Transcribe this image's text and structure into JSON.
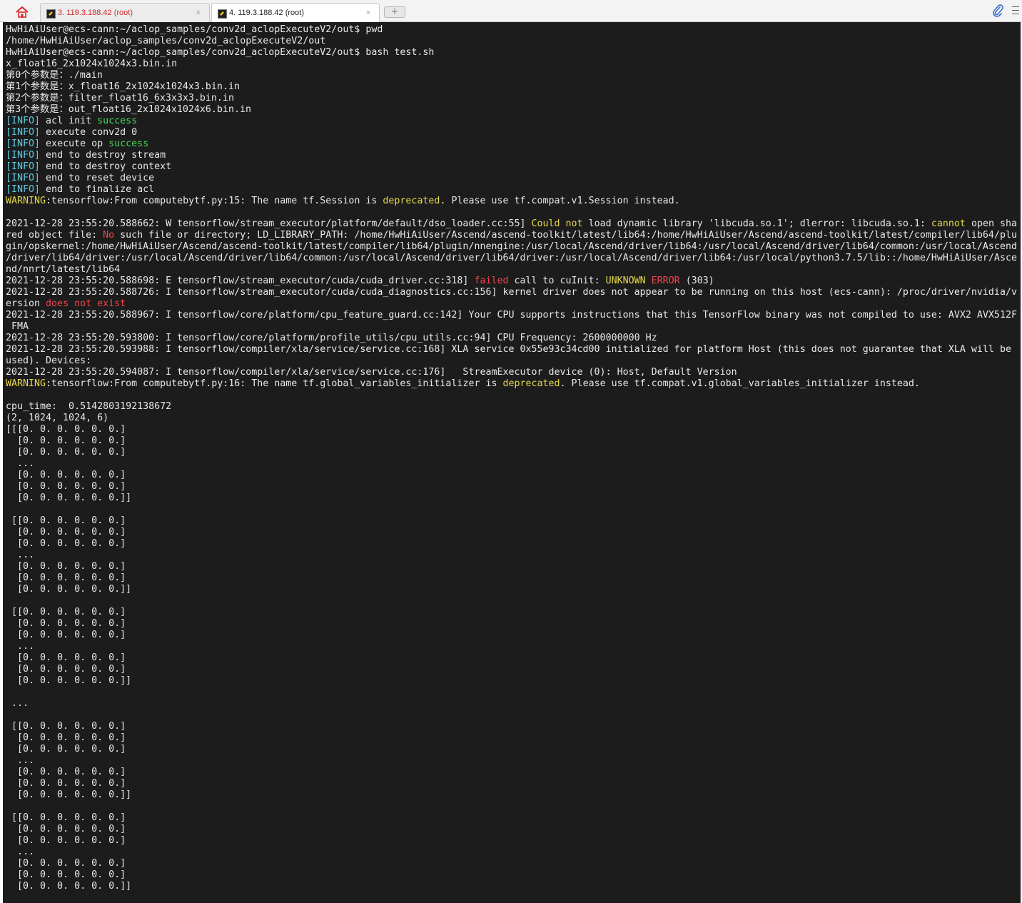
{
  "tabs": {
    "home_icon": "home-icon",
    "items": [
      {
        "label": "3. 119.3.188.42 (root)",
        "close": "×",
        "state": "inactive",
        "color": "#d9262b"
      },
      {
        "label": "4. 119.3.188.42 (root)",
        "close": "×",
        "state": "active",
        "color": "#222222"
      }
    ],
    "new_tab_label": "+"
  },
  "toolbar": {
    "attach_icon": "paperclip-icon",
    "menu_icon": "hamburger-menu-icon"
  },
  "colors": {
    "background": "#1c1c1c",
    "text": "#e8e8e8",
    "info": "#5fc8df",
    "success": "#45d85e",
    "warning": "#e6d94a",
    "error": "#f0464b"
  },
  "terminal": {
    "lines": [
      [
        {
          "t": "HwHiAiUser@ecs-cann:~/aclop_samples/conv2d_aclopExecuteV2/out$ pwd"
        }
      ],
      [
        {
          "t": "/home/HwHiAiUser/aclop_samples/conv2d_aclopExecuteV2/out"
        }
      ],
      [
        {
          "t": "HwHiAiUser@ecs-cann:~/aclop_samples/conv2d_aclopExecuteV2/out$ bash test.sh"
        }
      ],
      [
        {
          "t": "x_float16_2x1024x1024x3.bin.in"
        }
      ],
      [
        {
          "t": "第0个参数是：./main"
        }
      ],
      [
        {
          "t": "第1个参数是：x_float16_2x1024x1024x3.bin.in"
        }
      ],
      [
        {
          "t": "第2个参数是：filter_float16_6x3x3x3.bin.in"
        }
      ],
      [
        {
          "t": "第3个参数是：out_float16_2x1024x1024x6.bin.in"
        }
      ],
      [
        {
          "t": "[INFO]",
          "c": "c"
        },
        {
          "t": " acl init "
        },
        {
          "t": "success",
          "c": "g"
        }
      ],
      [
        {
          "t": "[INFO]",
          "c": "c"
        },
        {
          "t": " execute conv2d 0"
        }
      ],
      [
        {
          "t": "[INFO]",
          "c": "c"
        },
        {
          "t": " execute op "
        },
        {
          "t": "success",
          "c": "g"
        }
      ],
      [
        {
          "t": "[INFO]",
          "c": "c"
        },
        {
          "t": " end to destroy stream"
        }
      ],
      [
        {
          "t": "[INFO]",
          "c": "c"
        },
        {
          "t": " end to destroy context"
        }
      ],
      [
        {
          "t": "[INFO]",
          "c": "c"
        },
        {
          "t": " end to reset device"
        }
      ],
      [
        {
          "t": "[INFO]",
          "c": "c"
        },
        {
          "t": " end to finalize acl"
        }
      ],
      [
        {
          "t": "WARNING",
          "c": "y"
        },
        {
          "t": ":tensorflow:From computebytf.py:15: The name tf.Session is "
        },
        {
          "t": "deprecated",
          "c": "y"
        },
        {
          "t": ". Please use tf.compat.v1.Session instead."
        }
      ],
      [
        {
          "t": ""
        }
      ],
      [
        {
          "t": "2021-12-28 23:55:20.588662: W tensorflow/stream_executor/platform/default/dso_loader.cc:55] "
        },
        {
          "t": "Could not",
          "c": "y"
        },
        {
          "t": " load dynamic library 'libcuda.so.1'; dlerror: libcuda.so.1: "
        },
        {
          "t": "cannot",
          "c": "y"
        },
        {
          "t": " open sha"
        }
      ],
      [
        {
          "t": "red object file: "
        },
        {
          "t": "No",
          "c": "r"
        },
        {
          "t": " such file or directory; LD_LIBRARY_PATH: /home/HwHiAiUser/Ascend/ascend-toolkit/latest/lib64:/home/HwHiAiUser/Ascend/ascend-toolkit/latest/compiler/lib64/plu"
        }
      ],
      [
        {
          "t": "gin/opskernel:/home/HwHiAiUser/Ascend/ascend-toolkit/latest/compiler/lib64/plugin/nnengine:/usr/local/Ascend/driver/lib64:/usr/local/Ascend/driver/lib64/common:/usr/local/Ascend"
        }
      ],
      [
        {
          "t": "/driver/lib64/driver:/usr/local/Ascend/driver/lib64/common:/usr/local/Ascend/driver/lib64/driver:/usr/local/Ascend/driver/lib64:/usr/local/python3.7.5/lib::/home/HwHiAiUser/Asce"
        }
      ],
      [
        {
          "t": "nd/nnrt/latest/lib64"
        }
      ],
      [
        {
          "t": "2021-12-28 23:55:20.588698: E tensorflow/stream_executor/cuda/cuda_driver.cc:318] "
        },
        {
          "t": "failed",
          "c": "r"
        },
        {
          "t": " call to cuInit: "
        },
        {
          "t": "UNKNOWN",
          "c": "y"
        },
        {
          "t": " "
        },
        {
          "t": "ERROR",
          "c": "r"
        },
        {
          "t": " (303)"
        }
      ],
      [
        {
          "t": "2021-12-28 23:55:20.588726: I tensorflow/stream_executor/cuda/cuda_diagnostics.cc:156] kernel driver does not appear to be running on this host (ecs-cann): /proc/driver/nvidia/v"
        }
      ],
      [
        {
          "t": "ersion "
        },
        {
          "t": "does not exist",
          "c": "r"
        }
      ],
      [
        {
          "t": "2021-12-28 23:55:20.588967: I tensorflow/core/platform/cpu_feature_guard.cc:142] Your CPU supports instructions that this TensorFlow binary was not compiled to use: AVX2 AVX512F"
        }
      ],
      [
        {
          "t": " FMA"
        }
      ],
      [
        {
          "t": "2021-12-28 23:55:20.593800: I tensorflow/core/platform/profile_utils/cpu_utils.cc:94] CPU Frequency: 2600000000 Hz"
        }
      ],
      [
        {
          "t": "2021-12-28 23:55:20.593988: I tensorflow/compiler/xla/service/service.cc:168] XLA service 0x55e93c34cd00 initialized for platform Host (this does not guarantee that XLA will be"
        }
      ],
      [
        {
          "t": "used). Devices:"
        }
      ],
      [
        {
          "t": "2021-12-28 23:55:20.594087: I tensorflow/compiler/xla/service/service.cc:176]   StreamExecutor device (0): Host, Default Version"
        }
      ],
      [
        {
          "t": "WARNING",
          "c": "y"
        },
        {
          "t": ":tensorflow:From computebytf.py:16: The name tf.global_variables_initializer is "
        },
        {
          "t": "deprecated",
          "c": "y"
        },
        {
          "t": ". Please use tf.compat.v1.global_variables_initializer instead."
        }
      ],
      [
        {
          "t": ""
        }
      ],
      [
        {
          "t": "cpu_time:  0.5142803192138672"
        }
      ],
      [
        {
          "t": "(2, 1024, 1024, 6)"
        }
      ],
      [
        {
          "t": "[[[0. 0. 0. 0. 0. 0.]"
        }
      ],
      [
        {
          "t": "  [0. 0. 0. 0. 0. 0.]"
        }
      ],
      [
        {
          "t": "  [0. 0. 0. 0. 0. 0.]"
        }
      ],
      [
        {
          "t": "  ..."
        }
      ],
      [
        {
          "t": "  [0. 0. 0. 0. 0. 0.]"
        }
      ],
      [
        {
          "t": "  [0. 0. 0. 0. 0. 0.]"
        }
      ],
      [
        {
          "t": "  [0. 0. 0. 0. 0. 0.]]"
        }
      ],
      [
        {
          "t": ""
        }
      ],
      [
        {
          "t": " [[0. 0. 0. 0. 0. 0.]"
        }
      ],
      [
        {
          "t": "  [0. 0. 0. 0. 0. 0.]"
        }
      ],
      [
        {
          "t": "  [0. 0. 0. 0. 0. 0.]"
        }
      ],
      [
        {
          "t": "  ..."
        }
      ],
      [
        {
          "t": "  [0. 0. 0. 0. 0. 0.]"
        }
      ],
      [
        {
          "t": "  [0. 0. 0. 0. 0. 0.]"
        }
      ],
      [
        {
          "t": "  [0. 0. 0. 0. 0. 0.]]"
        }
      ],
      [
        {
          "t": ""
        }
      ],
      [
        {
          "t": " [[0. 0. 0. 0. 0. 0.]"
        }
      ],
      [
        {
          "t": "  [0. 0. 0. 0. 0. 0.]"
        }
      ],
      [
        {
          "t": "  [0. 0. 0. 0. 0. 0.]"
        }
      ],
      [
        {
          "t": "  ..."
        }
      ],
      [
        {
          "t": "  [0. 0. 0. 0. 0. 0.]"
        }
      ],
      [
        {
          "t": "  [0. 0. 0. 0. 0. 0.]"
        }
      ],
      [
        {
          "t": "  [0. 0. 0. 0. 0. 0.]]"
        }
      ],
      [
        {
          "t": ""
        }
      ],
      [
        {
          "t": " ..."
        }
      ],
      [
        {
          "t": ""
        }
      ],
      [
        {
          "t": " [[0. 0. 0. 0. 0. 0.]"
        }
      ],
      [
        {
          "t": "  [0. 0. 0. 0. 0. 0.]"
        }
      ],
      [
        {
          "t": "  [0. 0. 0. 0. 0. 0.]"
        }
      ],
      [
        {
          "t": "  ..."
        }
      ],
      [
        {
          "t": "  [0. 0. 0. 0. 0. 0.]"
        }
      ],
      [
        {
          "t": "  [0. 0. 0. 0. 0. 0.]"
        }
      ],
      [
        {
          "t": "  [0. 0. 0. 0. 0. 0.]]"
        }
      ],
      [
        {
          "t": ""
        }
      ],
      [
        {
          "t": " [[0. 0. 0. 0. 0. 0.]"
        }
      ],
      [
        {
          "t": "  [0. 0. 0. 0. 0. 0.]"
        }
      ],
      [
        {
          "t": "  [0. 0. 0. 0. 0. 0.]"
        }
      ],
      [
        {
          "t": "  ..."
        }
      ],
      [
        {
          "t": "  [0. 0. 0. 0. 0. 0.]"
        }
      ],
      [
        {
          "t": "  [0. 0. 0. 0. 0. 0.]"
        }
      ],
      [
        {
          "t": "  [0. 0. 0. 0. 0. 0.]]"
        }
      ]
    ]
  }
}
